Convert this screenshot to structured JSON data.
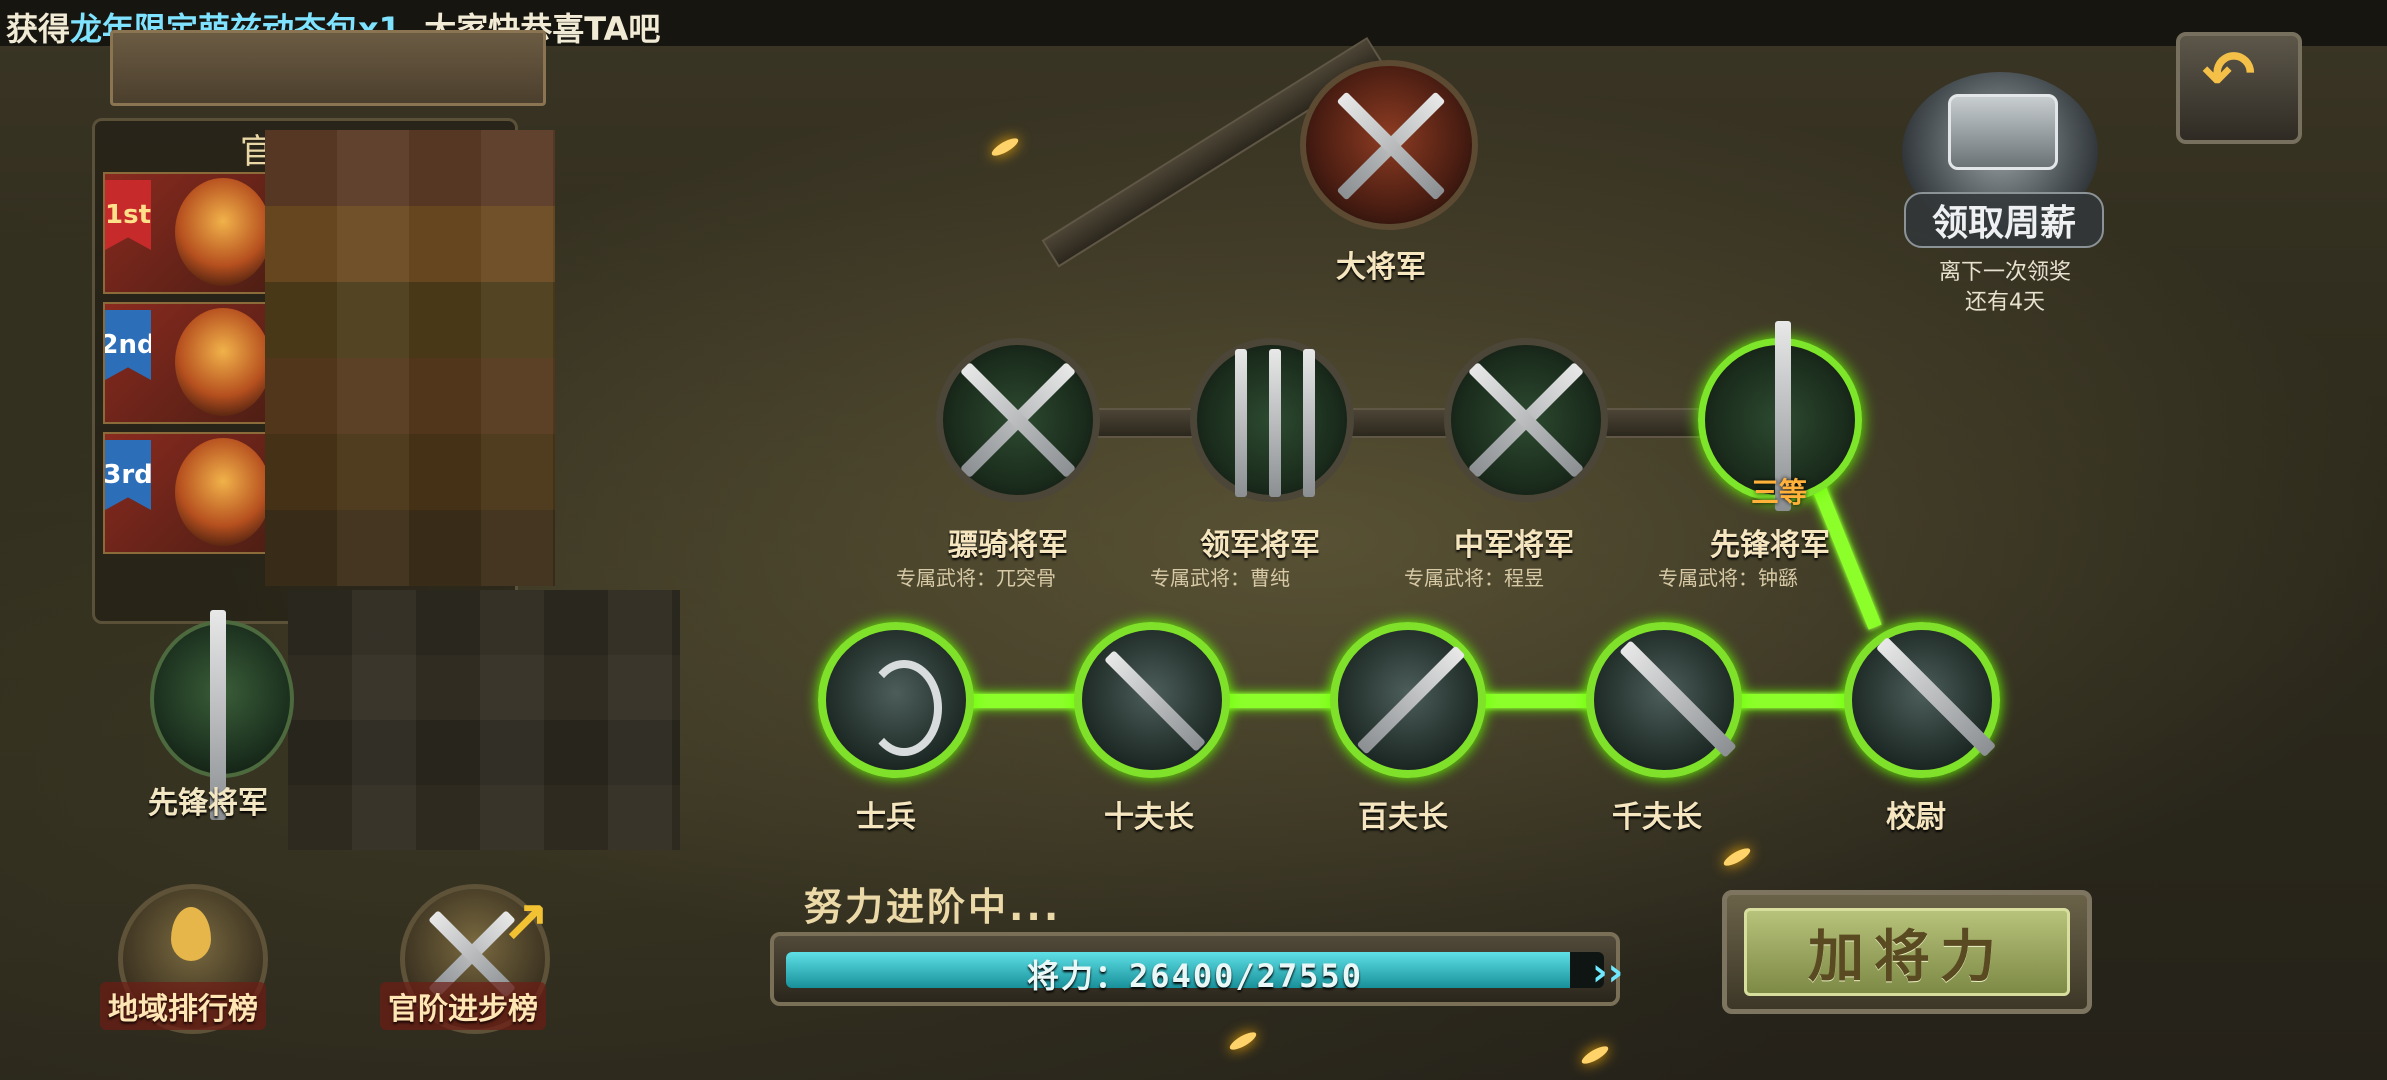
{
  "marquee": {
    "prefix": "获得",
    "highlight": "龙年限定",
    "item": "萌兹动态包x1",
    "suffix": ", 大家快恭喜TA吧"
  },
  "left_panel": {
    "title": "官阶排行",
    "ranks": [
      {
        "badge": "1st"
      },
      {
        "badge": "2nd"
      },
      {
        "badge": "3rd"
      }
    ],
    "my_rank_label": "先锋将军"
  },
  "tree": {
    "top": {
      "name": "大将军"
    },
    "middle": [
      {
        "name": "骠骑将军",
        "sub": "专属武将：兀突骨"
      },
      {
        "name": "领军将军",
        "sub": "专属武将：曹纯"
      },
      {
        "name": "中军将军",
        "sub": "专属武将：程昱"
      },
      {
        "name": "先锋将军",
        "sub": "专属武将：钟繇",
        "grade": "三等"
      }
    ],
    "bottom": [
      {
        "name": "士兵"
      },
      {
        "name": "十夫长"
      },
      {
        "name": "百夫长"
      },
      {
        "name": "千夫长"
      },
      {
        "name": "校尉"
      }
    ]
  },
  "chest": {
    "label": "领取周薪",
    "info_line1": "离下一次领奖",
    "info_line2": "还有4天"
  },
  "bottom_buttons": {
    "region_rank": "地域排行榜",
    "rank_progress": "官阶进步榜"
  },
  "progress": {
    "status": "努力进阶中...",
    "text": "将力：26400/27550",
    "current": 26400,
    "max": 27550
  },
  "add_button": {
    "label": "加将力"
  },
  "colors": {
    "glow": "#8cff2a",
    "progress": "#5fe0e6",
    "gold_text": "#f5e6c0",
    "highlight_text": "#7fe3ff"
  }
}
